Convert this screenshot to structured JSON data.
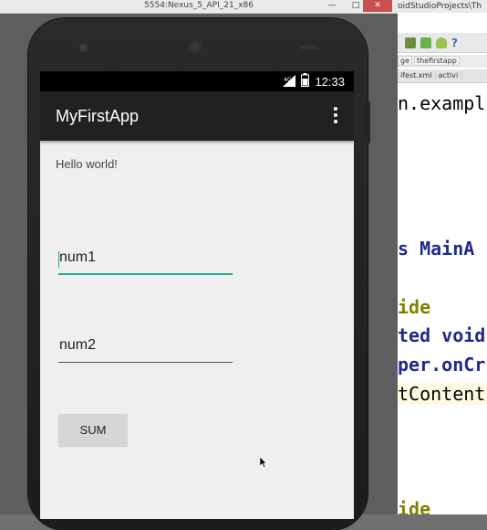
{
  "emulator": {
    "window_title": "5554:Nexus_5_API_21_x86",
    "window_controls": {
      "minimize": "—",
      "maximize": "□",
      "close": "✕"
    }
  },
  "status_bar": {
    "time": "12:33",
    "icons": [
      "signal-icon",
      "battery-icon"
    ]
  },
  "app": {
    "title": "MyFirstApp",
    "overflow_icon": "overflow-menu-icon",
    "hello_text": "Hello world!",
    "num1": {
      "value": "num1"
    },
    "num2": {
      "value": "num2"
    },
    "sum_button": "SUM"
  },
  "ide": {
    "window_title": "oidStudioProjects\\Th",
    "breadcrumbs": [
      "ge",
      "thefirstapp"
    ],
    "tabs": [
      "ifest.xml",
      "activi"
    ],
    "code_lines": [
      "n.exampl",
      "s MainA",
      "ide",
      "ted void",
      "per.onCr",
      "tContent",
      "ide"
    ]
  },
  "colors": {
    "action_bar": "#212121",
    "status_bar": "#000000",
    "accent": "#1fa99a",
    "screen_bg": "#efefef"
  }
}
